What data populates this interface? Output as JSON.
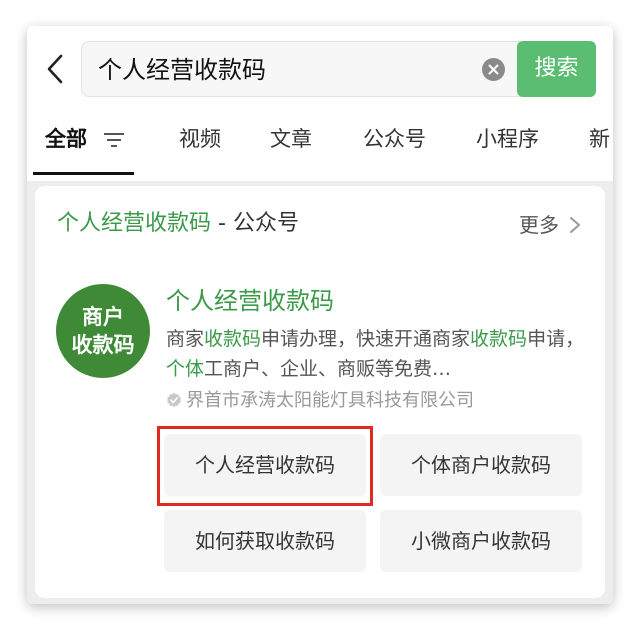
{
  "search": {
    "query": "个人经营收款码",
    "button_label": "搜索"
  },
  "tabs": [
    {
      "label": "全部",
      "active": true
    },
    {
      "label": "视频"
    },
    {
      "label": "文章"
    },
    {
      "label": "公众号"
    },
    {
      "label": "小程序"
    },
    {
      "label": "新"
    }
  ],
  "section": {
    "title_highlight": "个人经营收款码",
    "title_suffix": " - 公众号",
    "more_label": "更多"
  },
  "account": {
    "avatar_line1": "商户",
    "avatar_line2": "收款码",
    "name": "个人经营收款码",
    "desc_parts": [
      "商家",
      "收款码",
      "申请办理，快速开通商家",
      "收款码",
      "申请，",
      "个体",
      "工商户、企业、商贩等免费…"
    ],
    "company": "界首市承涛太阳能灯具科技有限公司"
  },
  "related": [
    "个人经营收款码",
    "个体商户收款码",
    "如何获取收款码",
    "小微商户收款码"
  ],
  "colors": {
    "accent": "#3b9a4a",
    "search_button": "#5bbd72",
    "annotation_box": "#e02a22"
  }
}
